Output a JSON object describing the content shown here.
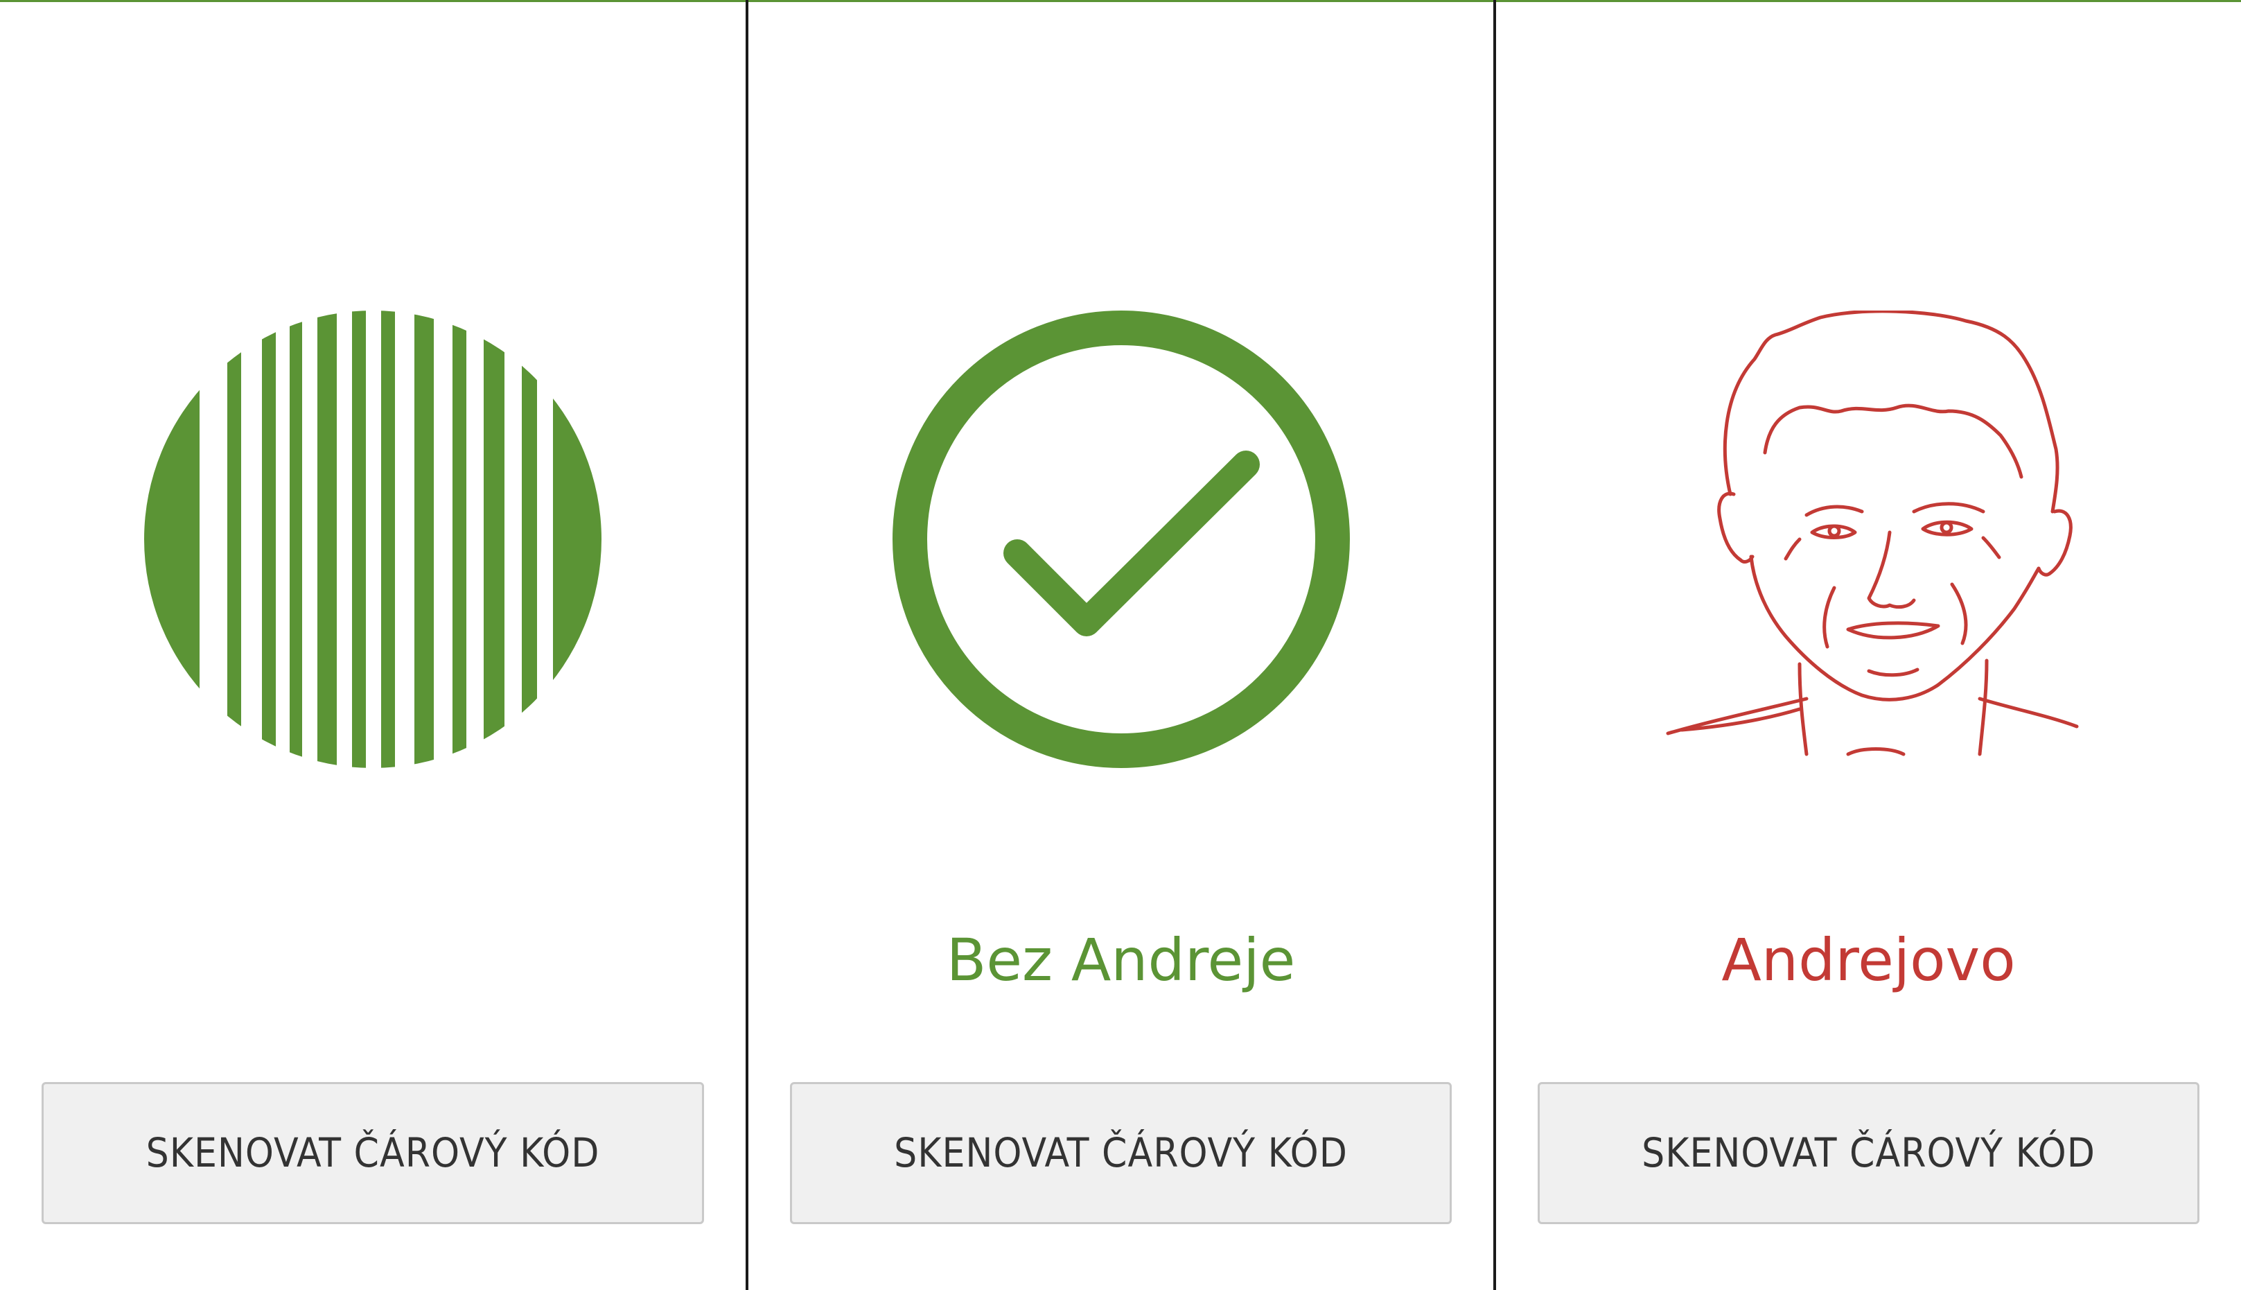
{
  "colors": {
    "green": "#5b9435",
    "red": "#c33a35",
    "button_bg": "#f0f0f0",
    "button_border": "#c9c9c9",
    "button_text": "#333333",
    "divider": "#1a1a1a"
  },
  "panels": [
    {
      "icon": "barcode-circle-icon",
      "result_text": "",
      "button_label": "SKENOVAT ČÁROVÝ KÓD"
    },
    {
      "icon": "check-circle-icon",
      "result_text": "Bez Andreje",
      "button_label": "SKENOVAT ČÁROVÝ KÓD"
    },
    {
      "icon": "portrait-sketch-icon",
      "result_text": "Andrejovo",
      "button_label": "SKENOVAT ČÁROVÝ KÓD"
    }
  ]
}
